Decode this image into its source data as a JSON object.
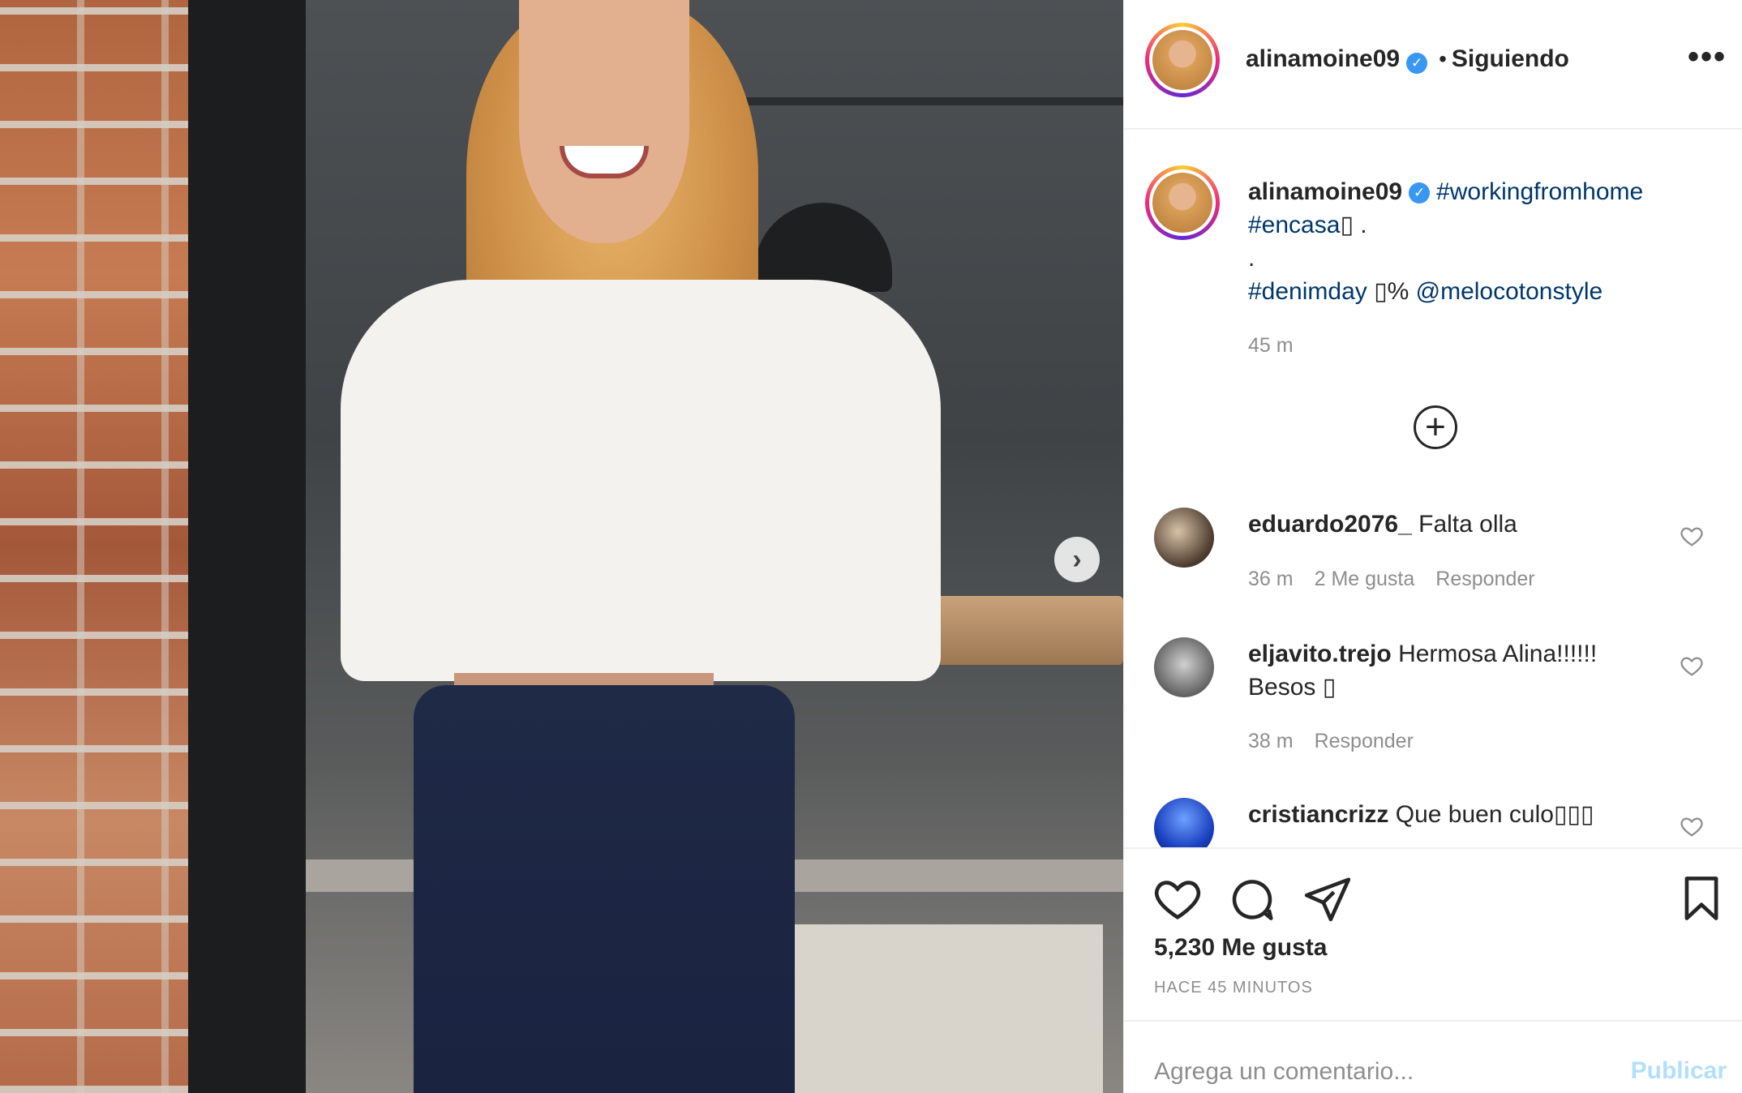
{
  "post": {
    "image_description": "",
    "next_icon": "chevron-right-icon"
  },
  "header": {
    "username": "alinamoine09",
    "verified_icon": "verified-badge-icon",
    "separator": "•",
    "follow_status": "Siguiendo",
    "more_icon": "more-options-icon",
    "more_label": "•••"
  },
  "caption": {
    "username": "alinamoine09",
    "line1_tag": "#workingfromhome",
    "line2_tag": "#encasa",
    "line2_rest": "▯ .",
    "line3": ".",
    "line4_tag": "#denimday",
    "line4_mid": " ▯% ",
    "line4_mention": "@melocotonstyle",
    "time": "45 m"
  },
  "load_more_icon": "plus-circle-icon",
  "comments": [
    {
      "username": "eduardo2076_",
      "text": "Falta olla",
      "time": "36 m",
      "likes": "2 Me gusta",
      "reply": "Responder"
    },
    {
      "username": "eljavito.trejo",
      "text": "Hermosa Alina!!!!!! Besos ▯",
      "time": "38 m",
      "reply": "Responder"
    },
    {
      "username": "cristiancrizz",
      "text": "Que buen culo▯▯▯"
    }
  ],
  "actions": {
    "like_icon": "heart-icon",
    "comment_icon": "comment-icon",
    "share_icon": "send-icon",
    "save_icon": "bookmark-icon",
    "likes_count": "5,230 Me gusta",
    "time_ago": "HACE 45 MINUTOS"
  },
  "add_comment": {
    "placeholder": "Agrega un comentario...",
    "publish_label": "Publicar"
  },
  "colors": {
    "link": "#00376b",
    "meta": "#8e8e8e",
    "verified": "#3897f0",
    "publish_disabled": "#b2dffc"
  }
}
